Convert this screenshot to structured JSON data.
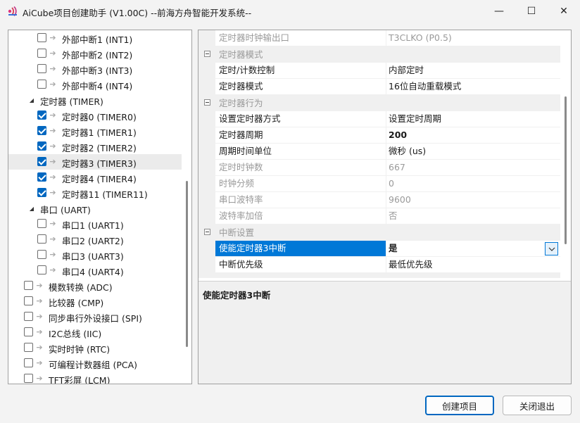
{
  "window": {
    "title": "AiCube项目创建助手 (V1.00C) --前海方舟智能开发系统--",
    "minimize_glyph": "—",
    "maximize_glyph": "☐",
    "close_glyph": "✕"
  },
  "tree": {
    "rows": [
      {
        "label": "外部中断1 (INT1)",
        "level": 2,
        "checked": false,
        "expander": ""
      },
      {
        "label": "外部中断2 (INT2)",
        "level": 2,
        "checked": false,
        "expander": ""
      },
      {
        "label": "外部中断3 (INT3)",
        "level": 2,
        "checked": false,
        "expander": ""
      },
      {
        "label": "外部中断4 (INT4)",
        "level": 2,
        "checked": false,
        "expander": ""
      },
      {
        "label": "定时器 (TIMER)",
        "level": 1,
        "checked": null,
        "expander": "◢"
      },
      {
        "label": "定时器0 (TIMER0)",
        "level": 2,
        "checked": true,
        "expander": ""
      },
      {
        "label": "定时器1 (TIMER1)",
        "level": 2,
        "checked": true,
        "expander": ""
      },
      {
        "label": "定时器2 (TIMER2)",
        "level": 2,
        "checked": true,
        "expander": ""
      },
      {
        "label": "定时器3 (TIMER3)",
        "level": 2,
        "checked": true,
        "expander": "",
        "selected": true
      },
      {
        "label": "定时器4 (TIMER4)",
        "level": 2,
        "checked": true,
        "expander": ""
      },
      {
        "label": "定时器11 (TIMER11)",
        "level": 2,
        "checked": true,
        "expander": ""
      },
      {
        "label": "串口 (UART)",
        "level": 1,
        "checked": null,
        "expander": "◢"
      },
      {
        "label": "串口1 (UART1)",
        "level": 2,
        "checked": false,
        "expander": ""
      },
      {
        "label": "串口2 (UART2)",
        "level": 2,
        "checked": false,
        "expander": ""
      },
      {
        "label": "串口3 (UART3)",
        "level": 2,
        "checked": false,
        "expander": ""
      },
      {
        "label": "串口4 (UART4)",
        "level": 2,
        "checked": false,
        "expander": ""
      },
      {
        "label": "模数转换 (ADC)",
        "level": 0,
        "checked": false,
        "expander": ""
      },
      {
        "label": "比较器 (CMP)",
        "level": 0,
        "checked": false,
        "expander": ""
      },
      {
        "label": "同步串行外设接口 (SPI)",
        "level": 0,
        "checked": false,
        "expander": ""
      },
      {
        "label": "I2C总线 (IIC)",
        "level": 0,
        "checked": false,
        "expander": ""
      },
      {
        "label": "实时时钟 (RTC)",
        "level": 0,
        "checked": false,
        "expander": ""
      },
      {
        "label": "可编程计数器组 (PCA)",
        "level": 0,
        "checked": false,
        "expander": ""
      },
      {
        "label": "TFT彩屏 (LCM)",
        "level": 0,
        "checked": false,
        "expander": ""
      }
    ],
    "arrow_glyph": "➔"
  },
  "grid": {
    "rows": [
      {
        "kind": "prop",
        "name": "定时器时钟输出口",
        "value": "T3CLKO (P0.5)",
        "state": "disabled"
      },
      {
        "kind": "cat",
        "name": "定时器模式"
      },
      {
        "kind": "prop",
        "name": "定时/计数控制",
        "value": "内部定时",
        "state": "normal"
      },
      {
        "kind": "prop",
        "name": "定时器模式",
        "value": "16位自动重载模式",
        "state": "normal"
      },
      {
        "kind": "cat",
        "name": "定时器行为"
      },
      {
        "kind": "prop",
        "name": "设置定时器方式",
        "value": "设置定时周期",
        "state": "normal"
      },
      {
        "kind": "prop",
        "name": "定时器周期",
        "value": "200",
        "state": "bold"
      },
      {
        "kind": "prop",
        "name": "周期时间单位",
        "value": "微秒 (us)",
        "state": "normal"
      },
      {
        "kind": "prop",
        "name": "定时时钟数",
        "value": "667",
        "state": "disabled"
      },
      {
        "kind": "prop",
        "name": "时钟分频",
        "value": "0",
        "state": "disabled"
      },
      {
        "kind": "prop",
        "name": "串口波特率",
        "value": "9600",
        "state": "disabled"
      },
      {
        "kind": "prop",
        "name": "波特率加倍",
        "value": "否",
        "state": "disabled"
      },
      {
        "kind": "cat",
        "name": "中断设置"
      },
      {
        "kind": "prop",
        "name": "使能定时器3中断",
        "value": "是",
        "state": "selected",
        "dropdown": true
      },
      {
        "kind": "prop",
        "name": "中断优先级",
        "value": "最低优先级",
        "state": "normal"
      }
    ]
  },
  "description": {
    "title": "使能定时器3中断"
  },
  "buttons": {
    "create": "创建项目",
    "exit": "关闭退出"
  },
  "colors": {
    "accent": "#0067c0",
    "selection": "#0078d7"
  }
}
